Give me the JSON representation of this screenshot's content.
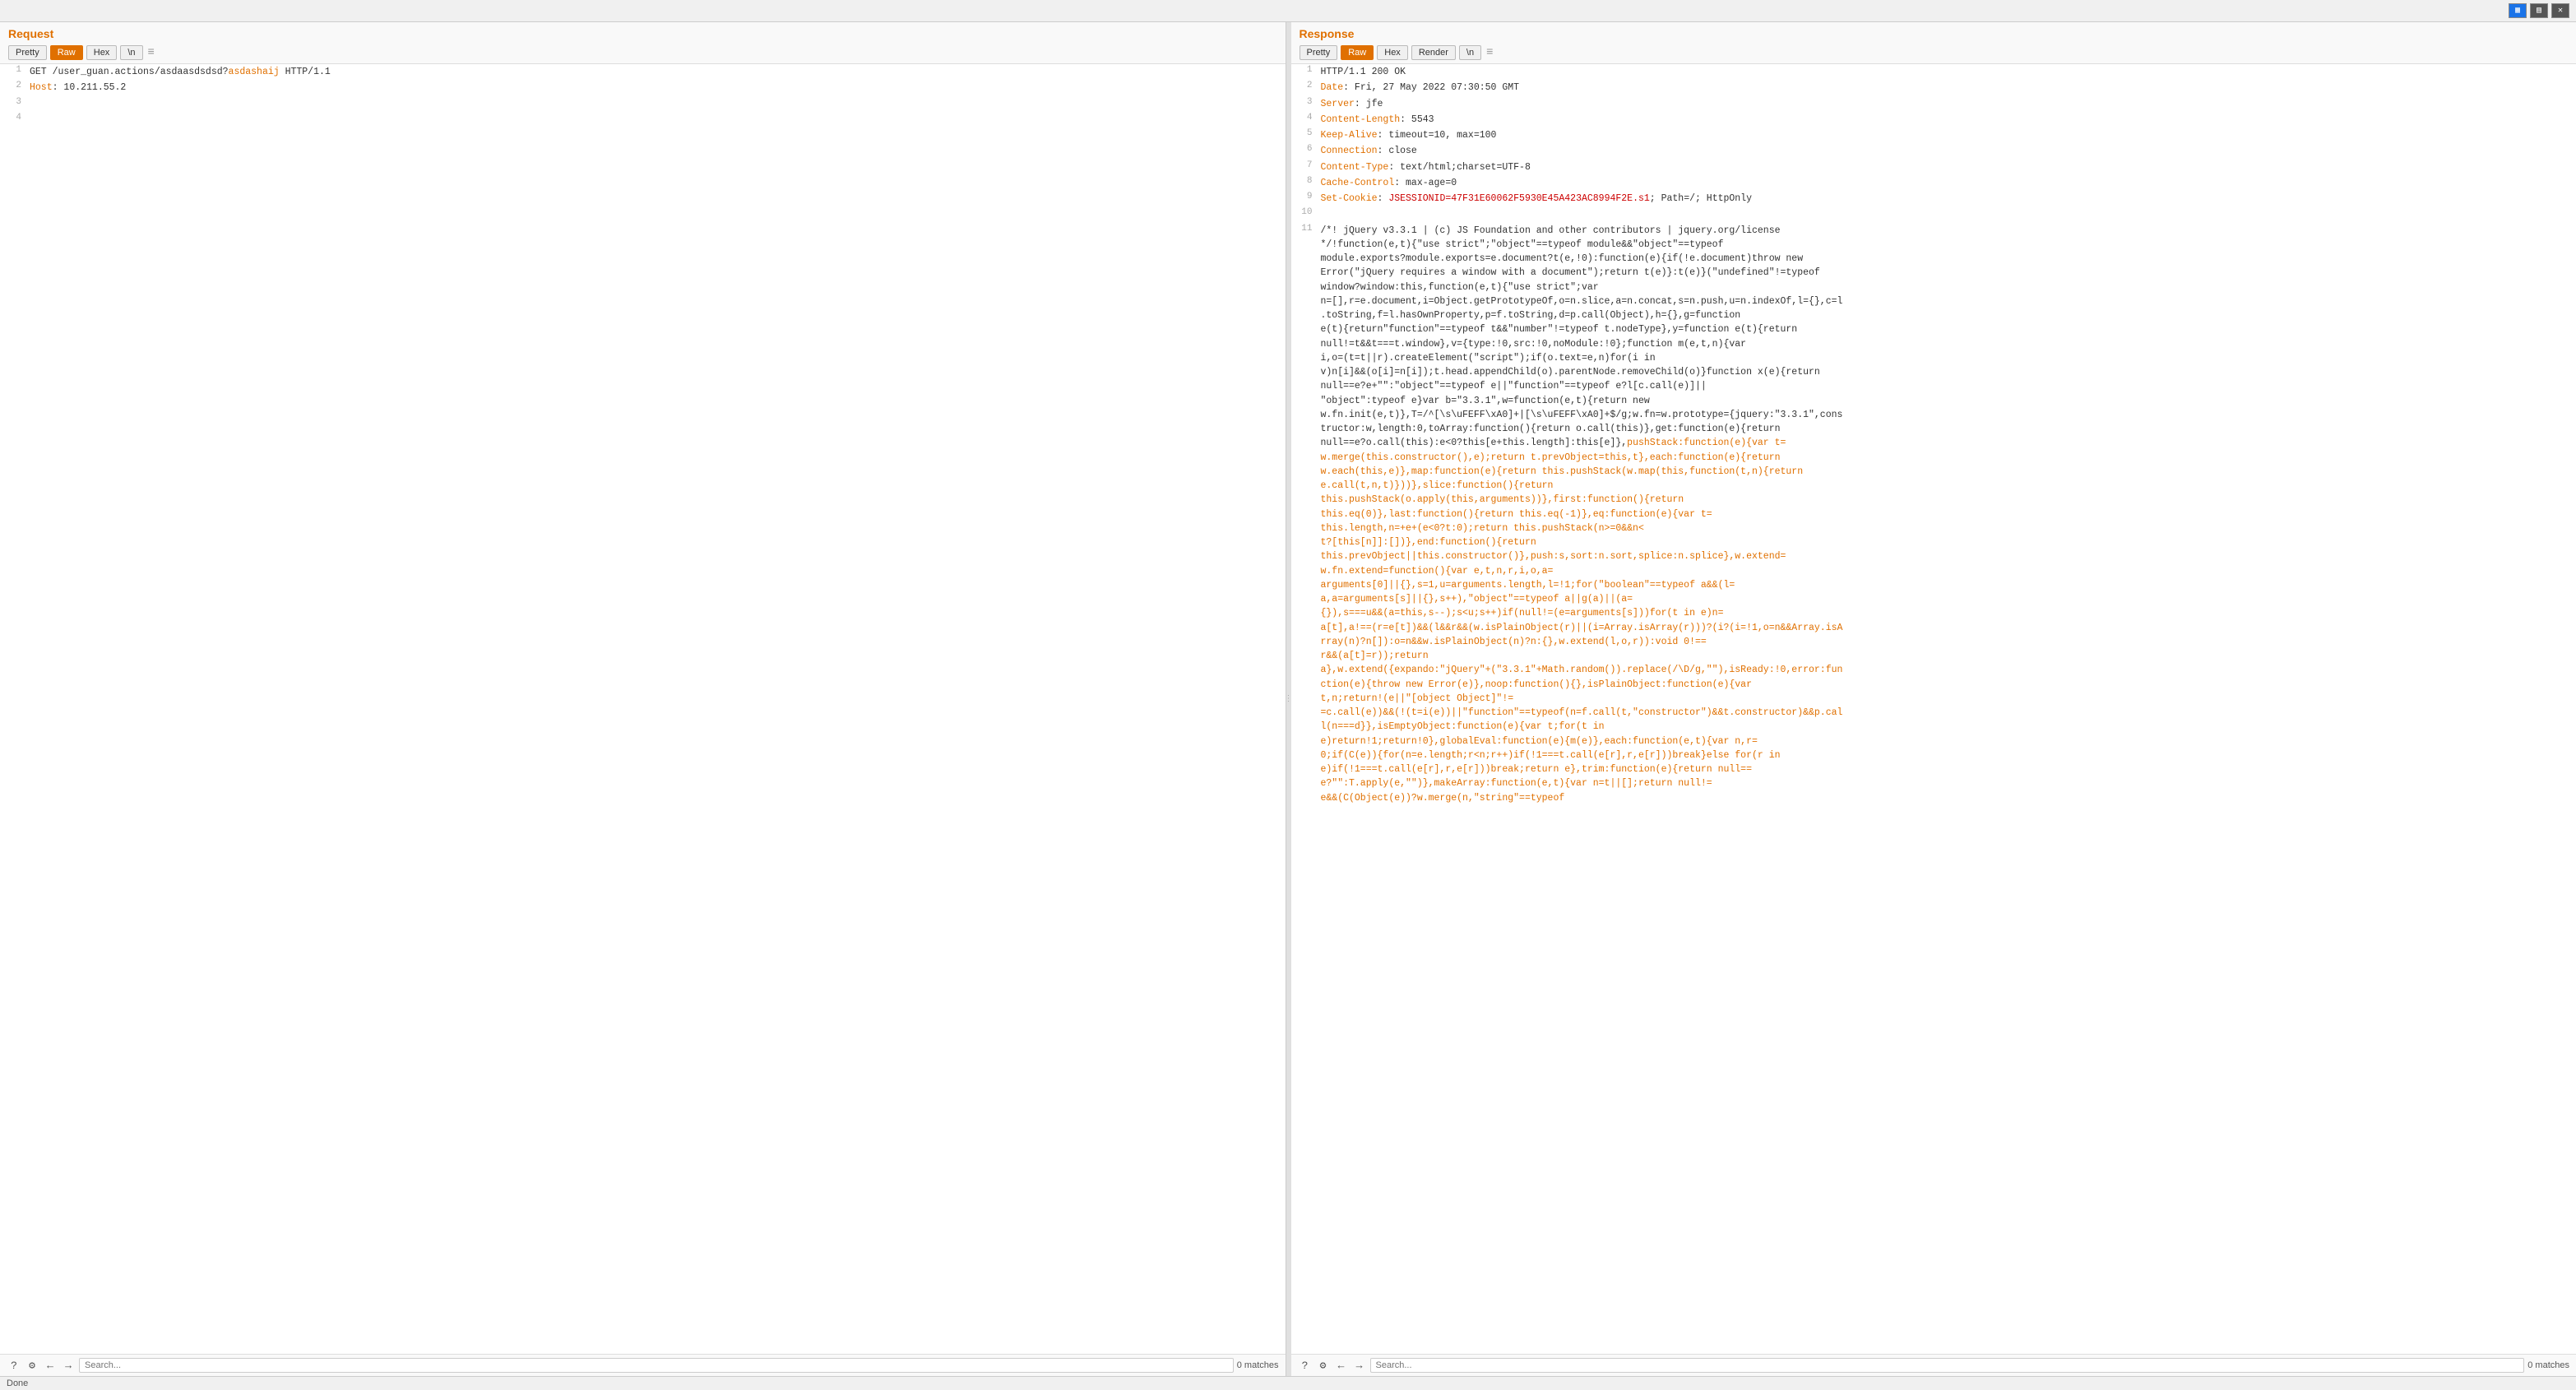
{
  "topbar": {
    "icons": [
      "split-horizontal",
      "split-vertical",
      "close-panel"
    ]
  },
  "request": {
    "title": "Request",
    "toolbar": {
      "buttons": [
        "Pretty",
        "Raw",
        "Hex",
        "\\n"
      ],
      "active": "Raw",
      "menu_icon": "≡"
    },
    "lines": [
      {
        "num": 1,
        "content": "GET /user_guan.actions/asdaasdsdsd?asdashaij HTTP/1.1",
        "type": "request-line"
      },
      {
        "num": 2,
        "content": "Host: 10.211.55.2",
        "type": "header"
      },
      {
        "num": 3,
        "content": "",
        "type": "blank"
      },
      {
        "num": 4,
        "content": "",
        "type": "blank"
      }
    ],
    "footer": {
      "search_placeholder": "Search...",
      "search_value": "",
      "match_count": "0 matches",
      "icons": [
        "?",
        "⚙",
        "←",
        "→"
      ]
    }
  },
  "response": {
    "title": "Response",
    "toolbar": {
      "buttons": [
        "Pretty",
        "Raw",
        "Hex",
        "Render",
        "\\n"
      ],
      "active": "Raw",
      "menu_icon": "≡"
    },
    "lines": [
      {
        "num": 1,
        "content": "HTTP/1.1 200 OK",
        "type": "status"
      },
      {
        "num": 2,
        "key": "Date",
        "value": "Fri, 27 May 2022 07:30:50 GMT",
        "type": "header"
      },
      {
        "num": 3,
        "key": "Server",
        "value": "jfe",
        "type": "header"
      },
      {
        "num": 4,
        "key": "Content-Length",
        "value": "5543",
        "type": "header"
      },
      {
        "num": 5,
        "key": "Keep-Alive",
        "value": "timeout=10, max=100",
        "type": "header"
      },
      {
        "num": 6,
        "key": "Connection",
        "value": "close",
        "type": "header"
      },
      {
        "num": 7,
        "key": "Content-Type",
        "value": "text/html;charset=UTF-8",
        "type": "header"
      },
      {
        "num": 8,
        "key": "Cache-Control",
        "value": "max-age=0",
        "type": "header"
      },
      {
        "num": 9,
        "key": "Set-Cookie",
        "value": "JSESSIONID=47F31E60062F5930E45A423AC8994F2E.s1; Path=/; HttpOnly",
        "type": "header-cookie"
      },
      {
        "num": 10,
        "content": "",
        "type": "blank"
      },
      {
        "num": 11,
        "content": "/*! jQuery v3.3.1 | (c) JS Foundation and other contributors | jquery.org/license\n*/!function(e,t){\"use strict\";\"object\"==typeof module&&\"object\"==typeof\nmodule.exports?module.exports=e.document?t(e,!0):function(e){if(!e.document)throw new\nError(\"jQuery requires a window with a document\");return t(e)}:t(e)}(\"undefined\"!=typeof\nwindow?window:this,function(e,t){\"use strict\";var\nn=[],r=e.document,i=Object.getPrototypeOf,o=n.slice,a=n.concat,s=n.push,u=n.indexOf,l={},c=l\n.toString,f=l.hasOwnProperty,p=f.toString,d=p.call(Object),h={},g=function\ne(t){return\"function\"==typeof t&&\"number\"!=typeof t.nodeType},y=function e(t){return\nnull!=t&&t===t.window},v={type:!0,src:!0,noModule:!0};function m(e,t,n){var\ni,o=(t=t||r).createElement(\"script\");if(o.text=e,n)for(i in\nv)n[i]&&(o[i]=n[i]);t.head.appendChild(o).parentNode.removeChild(o)}function x(e){return\nnull==e?e+\"\":\"object\"==typeof e||\"function\"==typeof e?l[c.call(e)]||\n\"object\":typeof e}var b=\"3.3.1\",w=function(e,t){return new\nw.fn.init(e,t)},T=/^[\\s\\uFEFF\\xA0]+|[\\s\\uFEFF\\xA0]+$/g;w.fn=w.prototype={jquery:\"3.3.1\",cons\ntructor:w,length:0,toArray:function(){return o.call(this)},get:function(e){return\nnull==e?o.call(this):e<0?this[e+this.length]:this[e]},pushStack:function(e){var t=\nw.merge(this.constructor(),e);return t.prevObject=this,t},each:function(e){return\nw.each(this,e)},map:function(e){return this.pushStack(w.map(this,function(t,n){return\ne.call(t,n,t)}))},slice:function(){return\nthis.pushStack(o.apply(this,arguments))},first:function(){return\nthis.eq(0)},last:function(){return this.eq(-1)},eq:function(e){var t=\nthis.length,n=+e+(e<0?t:0);return this.pushStack(n>=0&&n<\nt?[this[n]]:[])},end:function(){return\nthis.prevObject||this.constructor()},push:s,sort:n.sort,splice:n.splice},w.extend=\nw.fn.extend=function(){var e,t,n,r,i,o,a=\narguments[0]||{},s=1,u=arguments.length,l=!1;for(\"boolean\"==typeof a&&(l=\na,a=arguments[s]||{},s++),\"object\"==typeof a||g(a)||(a=\n{}),s===u&&(a=this,s--);s<u;s++)if(null!=(e=arguments[s]))for(t in e)n=\na[t],a!==(r=e[t])&&(l&&r&&(w.isPlainObject(r)||(i=Array.isArray(r)))?(i?(i=!1,o=n&&Array.isA\nrray(n)?n[]):o=n&&w.isPlainObject(n)?n:{},w.extend(l,o,r)):void 0!==\nr&&(a[t]=r));return\na},w.extend({expando:\"jQuery\"+(\"3.3.1\"+Math.random()).replace(/\\D/g,\"\"),isReady:!0,error:fun\nction(e){throw new Error(e)},noop:function(){},isPlainObject:function(e){var\nt,n;return!(e||\"[object Object]\"!=\n=c.call(e))&&(!(t=i(e))||\"function\"==typeof(n=f.call(t,\"constructor\")&&t.constructor)&&p.cal\nl(n===d}},isEmptyObject:function(e){var t;for(t in\ne)return!1;return!0},globalEval:function(e){m(e)},each:function(e,t){var n,r=\n0;if(C(e)){for(n=e.length;r<n;r++)if(!1===t.call(e[r],r,e[r]))break}else for(r in\ne)if(!1===t.call(e[r],r,e[r]))break;return e},trim:function(e){return null==\ne?\"\":T.apply(e,\"\")},makeArray:function(e,t){var n=t||[];return null!=\ne&&(C(Object(e))?w.merge(n,\"string\"==typeof",
        "type": "code"
      }
    ],
    "footer": {
      "search_placeholder": "Search...",
      "search_value": "",
      "match_count": "0 matches",
      "icons": [
        "?",
        "⚙",
        "←",
        "→"
      ]
    }
  },
  "statusbar": {
    "text": "Done"
  }
}
